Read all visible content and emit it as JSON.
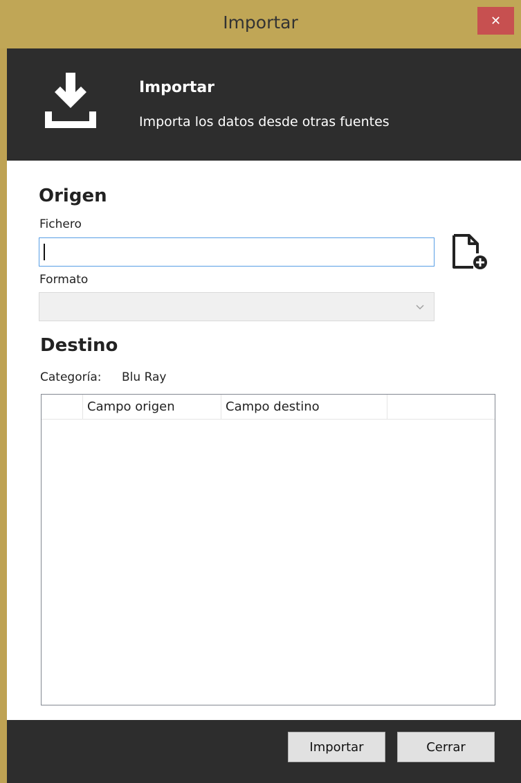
{
  "window": {
    "title": "Importar",
    "close_glyph": "✕"
  },
  "header": {
    "title": "Importar",
    "subtitle": "Importa los datos desde otras fuentes",
    "icon": "download-icon"
  },
  "origen": {
    "section_title": "Origen",
    "file_label": "Fichero",
    "file_value": "",
    "add_file_icon": "add-file-icon",
    "format_label": "Formato",
    "format_value": ""
  },
  "destino": {
    "section_title": "Destino",
    "category_label": "Categoría:",
    "category_value": "Blu Ray",
    "grid_columns": [
      "",
      "Campo origen",
      "Campo destino",
      ""
    ]
  },
  "footer": {
    "import_button": "Importar",
    "close_button": "Cerrar"
  },
  "colors": {
    "frame": "#c0a656",
    "dark_band": "#2d2d2d",
    "close_button": "#c75050",
    "input_focus_border": "#569de5"
  }
}
